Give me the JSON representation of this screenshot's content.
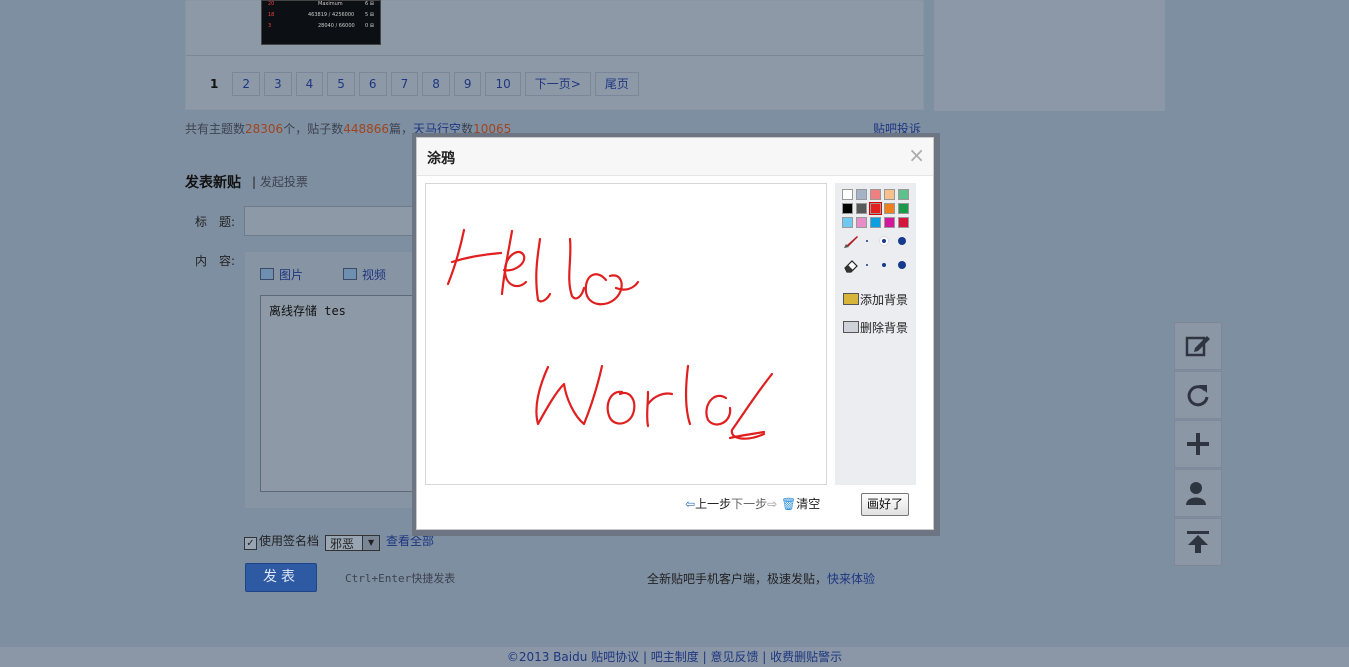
{
  "thumbnail": {
    "rows": [
      {
        "rank": "20",
        "text": "Maximum",
        "count": "6 ⊞"
      },
      {
        "rank": "18",
        "text": "463819 / 4256000",
        "count": "5 ⊞"
      },
      {
        "rank": "3",
        "text": "28040 / 66000",
        "count": "0 ⊞"
      }
    ]
  },
  "pager": {
    "current": "1",
    "pages": [
      "2",
      "3",
      "4",
      "5",
      "6",
      "7",
      "8",
      "9",
      "10"
    ],
    "next": "下一页>",
    "last": "尾页"
  },
  "stats": {
    "prefix": "共有主题数",
    "topics": "28306",
    "mid": "个，贴子数",
    "posts": "448866",
    "mid2": "篇，",
    "user": "天马行空",
    "mid3": "数",
    "user_count": "10065",
    "complain": "贴吧投诉"
  },
  "compose": {
    "heading": "发表新贴",
    "vote": "发起投票",
    "title_label": "标　题:",
    "content_label": "内　容:",
    "tool_image": "图片",
    "tool_video": "视频",
    "content_text": "离线存储 tes",
    "signature_label": "使用签名档",
    "signature_value": "邪恶",
    "view_all": "查看全部",
    "submit": "发表",
    "shortcut_hint": "Ctrl+Enter快捷发表",
    "mobile_prefix": "全新贴吧手机客户端，极速发贴，",
    "mobile_link": "快来体验"
  },
  "footer": {
    "text": "©2013 Baidu 贴吧协议 | 吧主制度 | 意见反馈 | 收费删贴警示"
  },
  "sidebar": {
    "icons": [
      "edit-icon",
      "refresh-icon",
      "plus-icon",
      "user-icon",
      "back-to-top-icon"
    ]
  },
  "modal": {
    "title": "涂鸦",
    "close": "×",
    "drawing_text": [
      "Hello",
      "World"
    ],
    "stroke_color": "#e02020",
    "palette": [
      "#ffffff",
      "#a6b2c6",
      "#f08080",
      "#f8c08a",
      "#5ec08a",
      "#000000",
      "#595959",
      "#e22020",
      "#f07f1e",
      "#1a9a4a",
      "#6fc8f0",
      "#e58ec8",
      "#0e9fe0",
      "#d4169c",
      "#d4163c"
    ],
    "selected_color": "#e22020",
    "add_bg": "添加背景",
    "remove_bg": "删除背景",
    "undo": "上一步",
    "redo": "下一步",
    "clear": "清空",
    "done": "画好了"
  }
}
